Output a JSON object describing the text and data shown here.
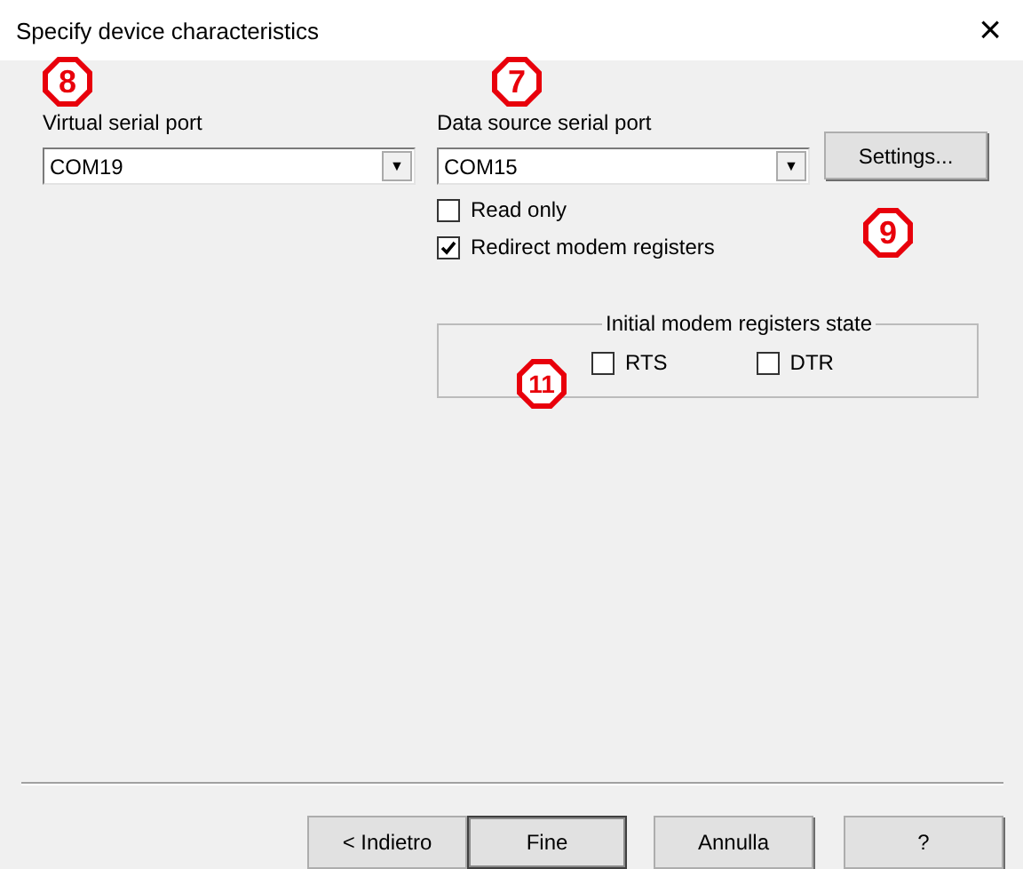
{
  "window": {
    "title": "Specify device characteristics",
    "close": "×"
  },
  "virtual_port": {
    "callout": "8",
    "label": "Virtual serial port",
    "value": "COM19",
    "arrow": "▼"
  },
  "source_port": {
    "callout": "7",
    "label": "Data source serial port",
    "value": "COM15",
    "arrow": "▼",
    "settings_button": "Settings...",
    "settings_callout": "9"
  },
  "options": [
    {
      "label": "Read only",
      "checked": false
    },
    {
      "label": "Redirect modem registers",
      "checked": true
    }
  ],
  "modem_group": {
    "title": "Initial modem registers state",
    "callout": "11",
    "registers": [
      {
        "label": "RTS",
        "checked": false
      },
      {
        "label": "DTR",
        "checked": false
      }
    ]
  },
  "buttons": [
    {
      "label": "< Indietro",
      "default": false
    },
    {
      "label": "Fine",
      "default": true
    },
    {
      "label": "Annulla",
      "default": false
    },
    {
      "label": "?",
      "default": false
    }
  ]
}
